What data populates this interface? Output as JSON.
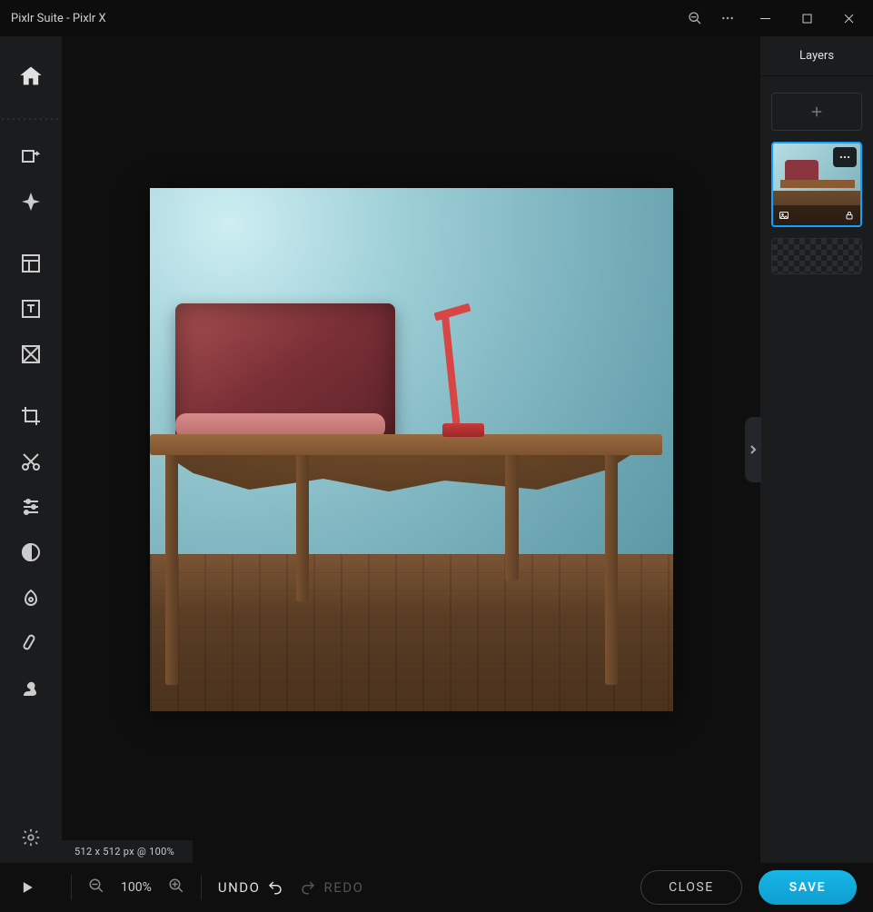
{
  "titlebar": {
    "title": "Pixlr Suite - Pixlr X"
  },
  "rightPanel": {
    "header": "Layers"
  },
  "canvas": {
    "dimensions": "512 x 512 px @ 100%"
  },
  "bottom": {
    "zoom": "100%",
    "undo": "UNDO",
    "redo": "REDO",
    "close": "CLOSE",
    "save": "SAVE"
  }
}
